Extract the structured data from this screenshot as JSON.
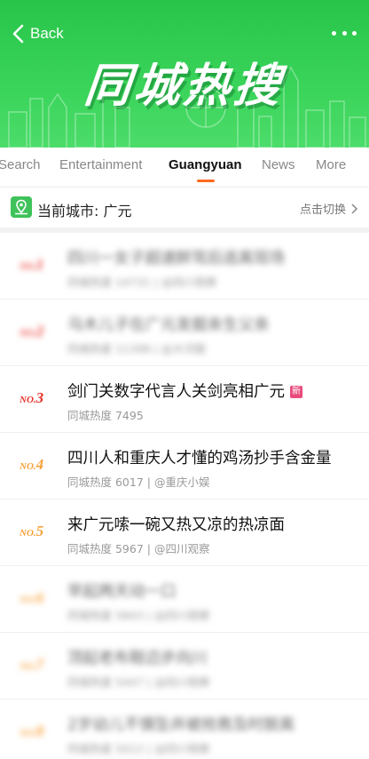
{
  "header": {
    "back_label": "Back",
    "title": "同城热搜",
    "bg_color": "#36cf54"
  },
  "tabs": [
    {
      "label": "Search",
      "active": false
    },
    {
      "label": "Entertainment",
      "active": false
    },
    {
      "label": "Guangyuan",
      "active": true
    },
    {
      "label": "News",
      "active": false
    },
    {
      "label": "More",
      "active": false
    }
  ],
  "city_bar": {
    "label": "当前城市: 广元",
    "switch_label": "点击切换"
  },
  "items": [
    {
      "rank": "1",
      "title": "四川一女子超速醉驾后逃离现场",
      "meta": "同城热度 14731 | @四川观察",
      "badge": ""
    },
    {
      "rank": "2",
      "title": "乌木儿子在广元发掘亲生父亲",
      "meta": "同城热度 11398 | @大河报",
      "badge": ""
    },
    {
      "rank": "3",
      "title": "剑门关数字代言人关剑亮相广元",
      "meta": "同城热度 7495",
      "badge": "新"
    },
    {
      "rank": "4",
      "title": "四川人和重庆人才懂的鸡汤抄手含金量",
      "meta": "同城热度 6017 | @重庆小娱",
      "badge": ""
    },
    {
      "rank": "5",
      "title": "来广元嗦一碗又热又凉的热凉面",
      "meta": "同城热度 5967 | @四川观察",
      "badge": ""
    },
    {
      "rank": "6",
      "title": "早起两天动一口",
      "meta": "同城热度 5843 | @四川观察",
      "badge": ""
    },
    {
      "rank": "7",
      "title": "顶起老布鞋迈步向川",
      "meta": "同城热度 5447 | @四川观察",
      "badge": ""
    },
    {
      "rank": "8",
      "title": "2岁幼儿不慎坠井被抢救及时脱离",
      "meta": "同城热度 5012 | @四川观察",
      "badge": ""
    }
  ],
  "rank_colors": {
    "top3": "#e8342c",
    "rest": "#f7a23b"
  }
}
